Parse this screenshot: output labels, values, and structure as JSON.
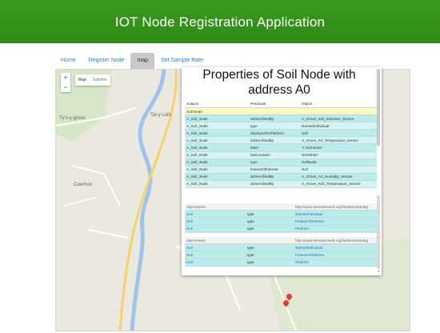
{
  "app": {
    "title": "IOT Node Registration Application"
  },
  "nav": {
    "items": [
      {
        "label": "Home",
        "active": false
      },
      {
        "label": "Register Node",
        "active": false
      },
      {
        "label": "map",
        "active": true
      },
      {
        "label": "Set Sample Rate",
        "active": false
      }
    ]
  },
  "map": {
    "type_buttons": {
      "map": "Map",
      "satellite": "Satellite"
    },
    "zoom": {
      "in": "+",
      "out": "−"
    },
    "labels": [
      "Ty'n-y-groes",
      "Tal-y-cafn",
      "Caerhun"
    ]
  },
  "popup": {
    "title": "Properties of Soil Node with address A0",
    "table": {
      "headers": [
        "Subject",
        "Predicate",
        "Object"
      ],
      "group": "Soil Node",
      "rows": [
        [
          "A_Soil_Node",
          "isDescribedBy",
          "A_Grove_Soil_Moisture_Sensor"
        ],
        [
          "A_Soil_Node",
          "type",
          "NamedIndividual"
        ],
        [
          "A_Soil_Node",
          "deployedOnPlatform",
          "Soil"
        ],
        [
          "A_Soil_Node",
          "isDescribedBy",
          "A_Grove_Air_Temperature_sensor"
        ],
        [
          "A_Soil_Node",
          "label",
          "'A Soil Node'"
        ],
        [
          "A_Soil_Node",
          "hasLocation",
          "Hierathlyn"
        ],
        [
          "A_Soil_Node",
          "type",
          "SoilNode"
        ],
        [
          "A_Soil_Node",
          "featureOfInterest",
          "Soil"
        ],
        [
          "A_Soil_Node",
          "isDescribedBy",
          "A_Grove_Air_Humidity_Sensor"
        ],
        [
          "A_Soil_Node",
          "isDescribedBy",
          "A_Grove_Soil_Temperature_Sensor"
        ]
      ]
    },
    "block1": {
      "header": [
        "objectname",
        "",
        "http://www.semanticweb.org/himbolo/ontolog"
      ],
      "rows": [
        [
          "Soil",
          "type",
          "NamedIndividual"
        ],
        [
          "Soil",
          "type",
          "FeatureOfInterest"
        ],
        [
          "Soil",
          "type",
          "Platform"
        ]
      ]
    },
    "block2": {
      "header": [
        "objectname",
        "",
        "http://www.semanticweb.org/himbolo/ontolog"
      ],
      "rows": [
        [
          "Soil",
          "type",
          "NamedIndividual"
        ],
        [
          "Soil",
          "type",
          "FeatureOfInterest"
        ],
        [
          "Soil",
          "type",
          "Platform"
        ]
      ]
    }
  }
}
